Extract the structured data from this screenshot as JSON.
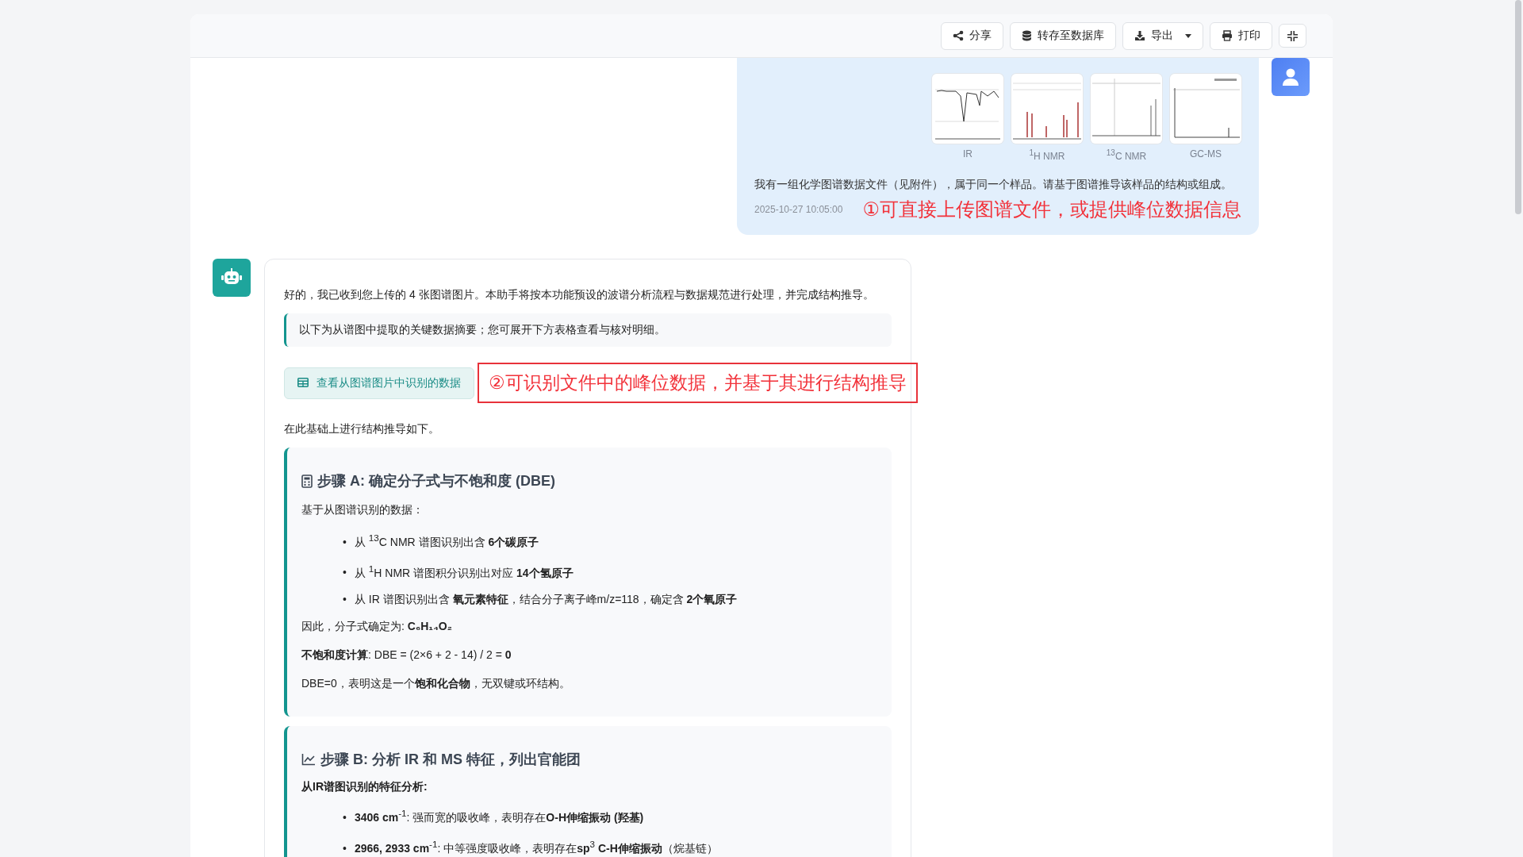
{
  "toolbar": {
    "buttons": [
      {
        "kind": "share",
        "label": "分享"
      },
      {
        "kind": "database",
        "label": "转存至数据库"
      },
      {
        "kind": "export",
        "label": "导出"
      },
      {
        "kind": "print",
        "label": "打印"
      },
      {
        "kind": "collapse"
      }
    ]
  },
  "user_message": {
    "attachments": [
      {
        "kind": "ir",
        "label": "IR"
      },
      {
        "kind": "hnmr",
        "label": "$^{1}$H NMR"
      },
      {
        "kind": "cnmr",
        "label": "$^{13}$C NMR"
      },
      {
        "kind": "gcms",
        "label": "GC-MS"
      }
    ],
    "text": "我有一组化学图谱数据文件（见附件），属于同一个样品。请基于图谱推导该样品的结构或组成。",
    "timestamp": "2025-10-27 10:05:00",
    "annotation": {
      "kind": "plain",
      "text": "①可直接上传图谱文件，或提供峰位数据信息"
    }
  },
  "bot_message": {
    "intro": "好的，我已收到您上传的 4 张图谱图片。本助手将按本功能预设的波谱分析流程与数据规范进行处理，并完成结构推导。",
    "note": "以下为从谱图中提取的关键数据摘要；您可展开下方表格查看与核对明细。",
    "data_button": "查看从图谱图片中识别的数据",
    "annotation": {
      "kind": "boxed",
      "text": "②可识别文件中的峰位数据，并基于其进行结构推导"
    },
    "followup": "在此基础上进行结构推导如下。",
    "steps": [
      {
        "title": "步骤 A: 确定分子式与不饱和度 (DBE)",
        "blocks": [
          {
            "kind": "para",
            "text": "基于从图谱识别的数据："
          },
          {
            "kind": "list",
            "marker": "•",
            "items": [
              "从 $^{13}$C NMR 谱图识别出含 **6个碳原子**",
              "从 $^{1}$H NMR 谱图积分识别出对应 **14个氢原子**",
              "从 IR 谱图识别出含 **氧元素特征**，结合分子离子峰m/z=118，确定含 **2个氧原子**"
            ]
          },
          {
            "kind": "para",
            "text": "因此，分子式确定为: **C₆H₁₄O₂**"
          },
          {
            "kind": "para",
            "text": "**不饱和度计算**: DBE = (2×6 + 2 - 14) / 2 = **0**"
          },
          {
            "kind": "para",
            "text": "DBE=0，表明这是一个**饱和化合物**，无双键或环结构。"
          }
        ]
      },
      {
        "title": "步骤 B: 分析 IR 和 MS 特征，列出官能团",
        "blocks": [
          {
            "kind": "heading",
            "text": "从IR谱图识别的特征分析:"
          },
          {
            "kind": "list",
            "marker": "•",
            "items": [
              "**3406 cm**$^{-1}$: 强而宽的吸收峰，表明存在**O-H伸缩振动 (羟基)**",
              "**2966, 2933 cm**$^{-1}$: 中等强度吸收峰，表明存在**sp**$^{3}$ **C-H伸缩振动**（烷基链）"
            ]
          }
        ]
      }
    ]
  }
}
